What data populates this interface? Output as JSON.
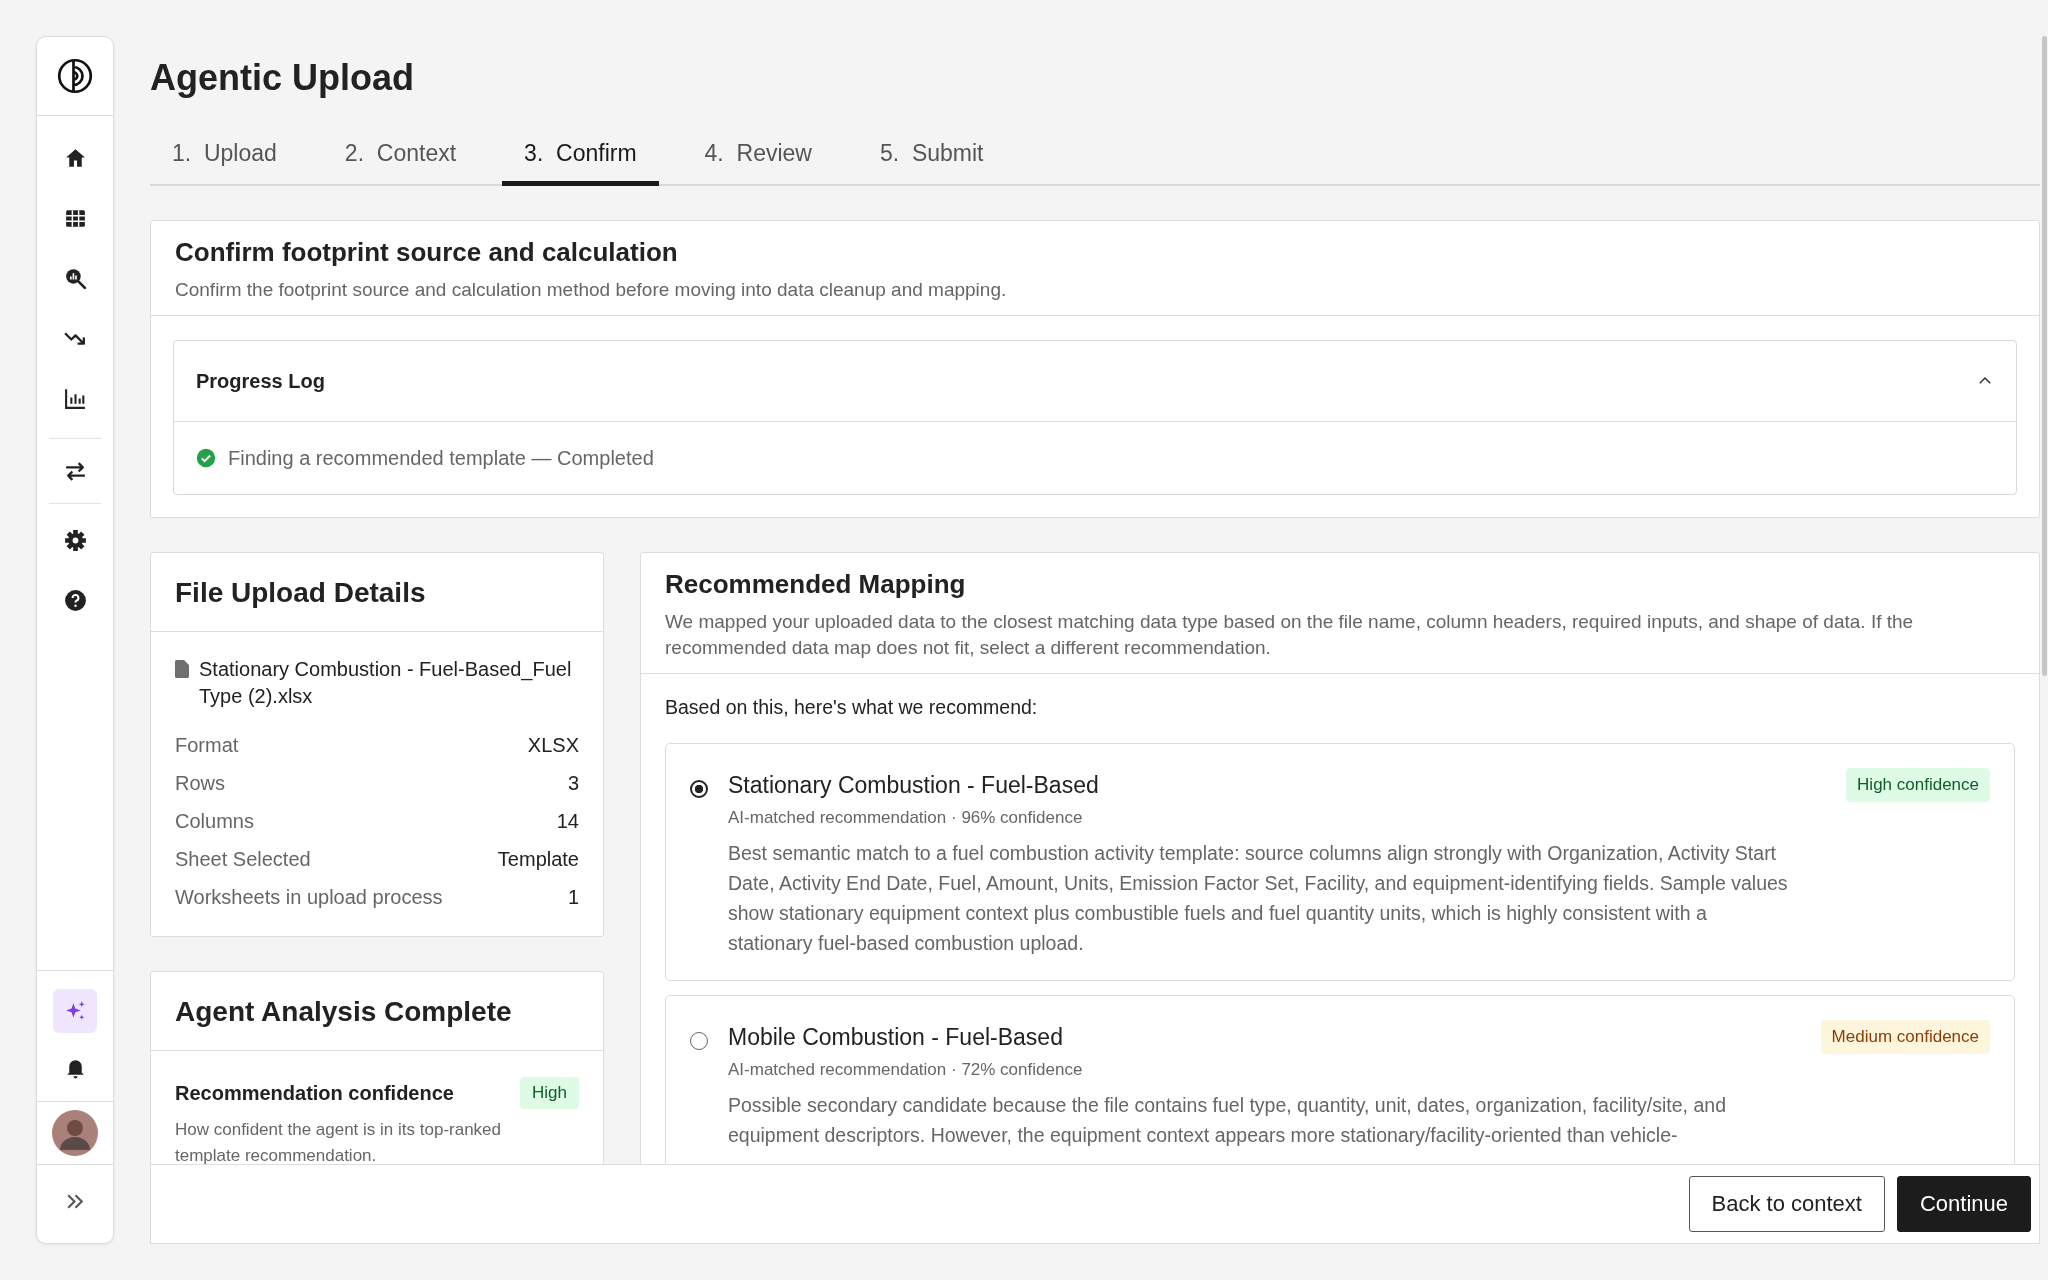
{
  "sidebar": {
    "top_items": [
      {
        "selected": false
      },
      {
        "selected": false
      },
      {
        "selected": false
      },
      {
        "selected": false
      },
      {
        "selected": false
      }
    ],
    "middle_items": [
      {
        "selected": false
      }
    ],
    "lower_items": [
      {
        "selected": false
      },
      {
        "selected": false
      }
    ],
    "bottom_items": [
      {
        "selected": true
      },
      {
        "selected": false
      }
    ]
  },
  "page_title": "Agentic Upload",
  "tabs": [
    {
      "label": "1.  Upload",
      "selected": false
    },
    {
      "label": "2.  Context",
      "selected": false
    },
    {
      "label": "3.  Confirm",
      "selected": true
    },
    {
      "label": "4.  Review",
      "selected": false
    },
    {
      "label": "5.  Submit",
      "selected": false
    }
  ],
  "confirm_section": {
    "title": "Confirm footprint source and calculation",
    "subtitle": "Confirm the footprint source and calculation method before moving into data cleanup and mapping.",
    "progress_log": {
      "title": "Progress Log",
      "expanded": true,
      "entries": [
        {
          "text": "Finding a recommended template — Completed"
        }
      ]
    }
  },
  "file_details": {
    "title": "File Upload Details",
    "file_name": "Stationary Combustion - Fuel-Based_Fuel Type (2).xlsx",
    "rows": [
      {
        "label": "Format",
        "value": "XLSX"
      },
      {
        "label": "Rows",
        "value": "3"
      },
      {
        "label": "Columns",
        "value": "14"
      },
      {
        "label": "Sheet Selected",
        "value": "Template"
      },
      {
        "label": "Worksheets in upload process",
        "value": "1"
      }
    ]
  },
  "agent_analysis": {
    "title": "Agent Analysis Complete",
    "items": [
      {
        "label": "Recommendation confidence",
        "badge": "High",
        "kind": "high",
        "description": "How confident the agent is in its top-ranked template recommendation."
      }
    ]
  },
  "mapping": {
    "title": "Recommended Mapping",
    "description": "We mapped your uploaded data to the closest matching data type based on the file name, column headers, required inputs, and shape of data. If the recommended data map does not fit, select a different recommendation.",
    "prompt": "Based on this, here's what we recommend:",
    "options": [
      {
        "title": "Stationary Combustion - Fuel-Based",
        "meta": "AI-matched recommendation · 96% confidence",
        "confidence": "High confidence",
        "kind": "high",
        "selected": true,
        "description": "Best semantic match to a fuel combustion activity template: source columns align strongly with Organization, Activity Start Date, Activity End Date, Fuel, Amount, Units, Emission Factor Set, Facility, and equipment-identifying fields. Sample values show stationary equipment context plus combustible fuels and fuel quantity units, which is highly consistent with a stationary fuel-based combustion upload."
      },
      {
        "title": "Mobile Combustion - Fuel-Based",
        "meta": "AI-matched recommendation · 72% confidence",
        "confidence": "Medium confidence",
        "kind": "medium",
        "selected": false,
        "description": "Possible secondary candidate because the file contains fuel type, quantity, unit, dates, organization, facility/site, and equipment descriptors. However, the equipment context appears more stationary/facility-oriented than vehicle-"
      }
    ]
  },
  "footer": {
    "buttons": [
      {
        "label": "Back to context",
        "kind": "secondary"
      },
      {
        "label": "Continue",
        "kind": "primary"
      }
    ]
  }
}
